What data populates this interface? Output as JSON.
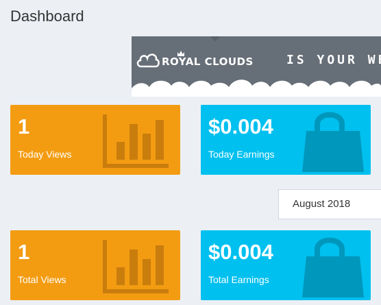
{
  "page": {
    "title": "Dashboard"
  },
  "banner": {
    "brand": "ROYAL CLOUDS",
    "tagline": "IS YOUR WE",
    "logo_icon": "cloud-icon",
    "crown_icon": "crown-icon"
  },
  "stats_today": {
    "views": {
      "value": "1",
      "label": "Today Views",
      "icon": "bar-chart-icon"
    },
    "earnings": {
      "value": "$0.004",
      "label": "Today Earnings",
      "icon": "shopping-bag-icon"
    }
  },
  "month_filter": {
    "selected": "August 2018"
  },
  "stats_total": {
    "views": {
      "value": "1",
      "label": "Total Views",
      "icon": "bar-chart-icon"
    },
    "earnings": {
      "value": "$0.004",
      "label": "Total Earnings",
      "icon": "shopping-bag-icon"
    }
  },
  "colors": {
    "views_card": "#f39c12",
    "earnings_card": "#00c0ef",
    "background": "#ecf0f5",
    "banner": "#666e77"
  }
}
